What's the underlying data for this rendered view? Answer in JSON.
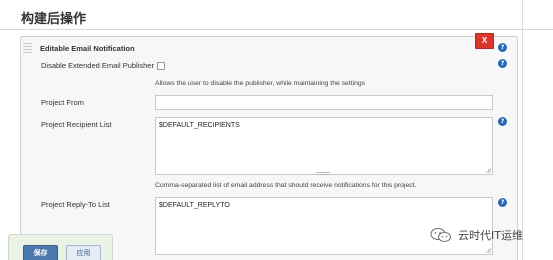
{
  "section": {
    "title": "构建后操作"
  },
  "panel": {
    "title": "Editable Email Notification",
    "delete_label": "X"
  },
  "fields": {
    "disable_publisher": {
      "label": "Disable Extended Email Publisher",
      "checked": false,
      "description": "Allows the user to disable the publisher, while maintaining the settings"
    },
    "project_from": {
      "label": "Project From",
      "value": ""
    },
    "recipient_list": {
      "label": "Project Recipient List",
      "value": "$DEFAULT_RECIPIENTS",
      "description": "Comma-separated list of email address that should receive notifications for this project."
    },
    "reply_to": {
      "label": "Project Reply-To List",
      "value": "$DEFAULT_REPLYTO"
    }
  },
  "help": {
    "glyph": "?"
  },
  "footer": {
    "save_label": "保存",
    "apply_label": "应用"
  },
  "watermark": {
    "text": "云时代IT运维"
  },
  "colors": {
    "delete_button": "#d9372c",
    "help_icon": "#2a66b6",
    "save_button": "#4b78ad",
    "footer_bar": "#eaf2e6"
  },
  "icons": [
    "drag-handle-icon",
    "help-icon",
    "wechat-icon",
    "resize-grip-icon"
  ]
}
